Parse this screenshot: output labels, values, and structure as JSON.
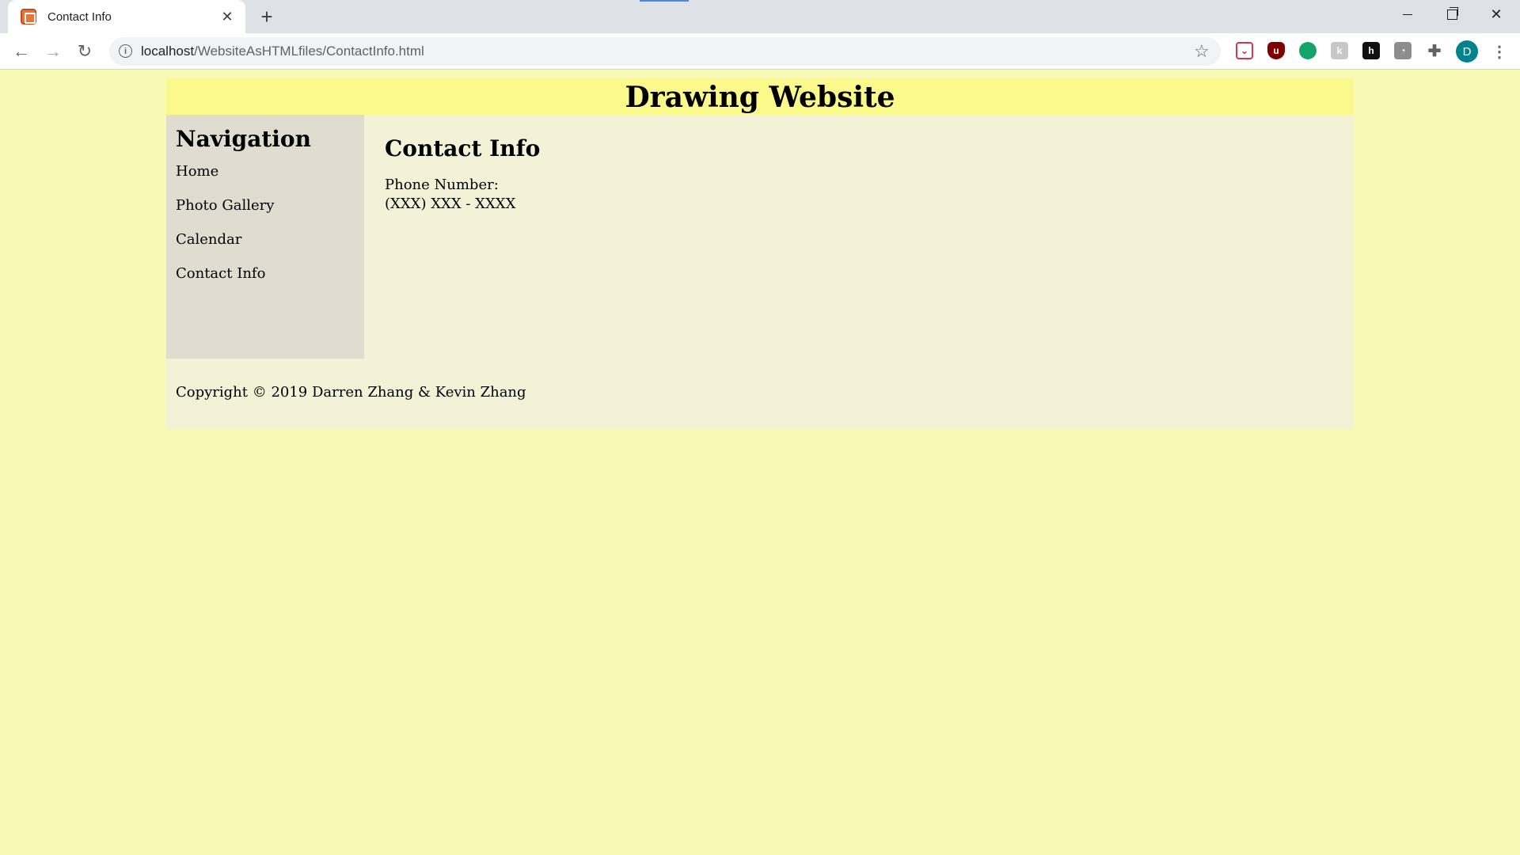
{
  "browser": {
    "tab_title": "Contact Info",
    "url_host": "localhost",
    "url_path": "/WebsiteAsHTMLfiles/ContactInfo.html",
    "profile_initial": "D",
    "icons": {
      "back": "arrow-left-icon",
      "forward": "arrow-right-icon",
      "reload": "reload-icon",
      "info": "info-icon",
      "bookmark": "star-icon",
      "extensions": "puzzle-icon",
      "menu": "kebab-menu-icon"
    }
  },
  "site": {
    "title": "Drawing Website",
    "nav": {
      "heading": "Navigation",
      "items": [
        {
          "label": "Home"
        },
        {
          "label": "Photo Gallery"
        },
        {
          "label": "Calendar"
        },
        {
          "label": "Contact Info"
        }
      ]
    },
    "main": {
      "heading": "Contact Info",
      "phone_label": "Phone Number:",
      "phone_value": "(XXX) XXX - XXXX"
    },
    "footer": "Copyright © 2019 Darren Zhang & Kevin Zhang"
  },
  "colors": {
    "page_bg": "#f9f9b6",
    "header_bg": "#fbf98a",
    "sidebar_bg": "#e0ddd0",
    "content_bg": "#f3f2d6"
  }
}
